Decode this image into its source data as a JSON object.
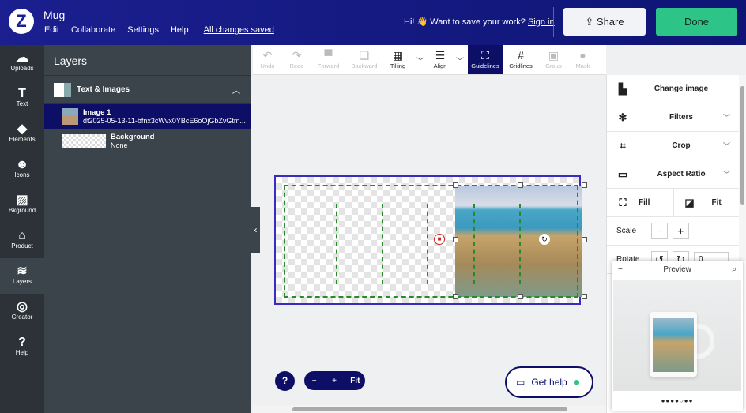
{
  "header": {
    "logo": "Z",
    "title": "Mug",
    "menu": [
      "Edit",
      "Collaborate",
      "Settings",
      "Help"
    ],
    "saved": "All changes saved",
    "greeting": "Hi! 👋 Want to save your work?",
    "signin": "Sign in",
    "share": "Share",
    "done": "Done"
  },
  "rail": [
    {
      "icon": "☁",
      "label": "Uploads"
    },
    {
      "icon": "T",
      "label": "Text"
    },
    {
      "icon": "◆",
      "label": "Elements"
    },
    {
      "icon": "☻",
      "label": "Icons"
    },
    {
      "icon": "▨",
      "label": "Bkground"
    },
    {
      "icon": "⌂",
      "label": "Product"
    },
    {
      "icon": "≋",
      "label": "Layers"
    },
    {
      "icon": "◎",
      "label": "Creator"
    },
    {
      "icon": "?",
      "label": "Help"
    }
  ],
  "layers": {
    "title": "Layers",
    "group": "Text & Images",
    "items": [
      {
        "name": "Image 1",
        "sub": "dt2025-05-13-11-bfnx3cWvx0YBcE6oOjGbZvGtm..."
      },
      {
        "name": "Background",
        "sub": "None"
      }
    ]
  },
  "toolbar": [
    {
      "icon": "↶",
      "label": "Undo"
    },
    {
      "icon": "↷",
      "label": "Redo"
    },
    {
      "icon": "▀",
      "label": "Forward"
    },
    {
      "icon": "❏",
      "label": "Backward"
    },
    {
      "icon": "▦",
      "label": "Tilling"
    },
    {
      "icon": "☰",
      "label": "Align"
    },
    {
      "icon": "⛶",
      "label": "Guidelines"
    },
    {
      "icon": "#",
      "label": "Gridlines"
    },
    {
      "icon": "▣",
      "label": "Group"
    },
    {
      "icon": "●",
      "label": "Mask"
    }
  ],
  "panel": {
    "change_image": "Change image",
    "filters": "Filters",
    "crop": "Crop",
    "aspect": "Aspect Ratio",
    "fill": "Fill",
    "fit": "Fit",
    "scale": "Scale",
    "rotate": "Rotate",
    "rotate_value": "0"
  },
  "preview": {
    "title": "Preview",
    "dots": "●●●●○●●"
  },
  "bottom": {
    "help": "?",
    "zoom_out": "−",
    "zoom_in": "+",
    "fit": "Fit",
    "get_help": "Get help"
  }
}
